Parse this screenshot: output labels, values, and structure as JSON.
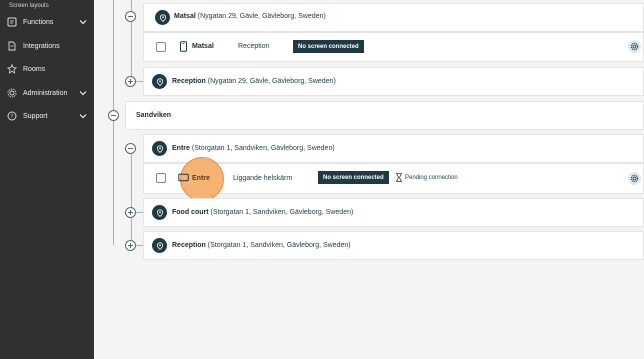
{
  "sidebar": {
    "breadcrumb": "Screen layouts",
    "items": [
      {
        "label": "Functions",
        "icon": "functions-icon",
        "has_chevron": true
      },
      {
        "label": "Integrations",
        "icon": "integrations-icon",
        "has_chevron": false
      },
      {
        "label": "Rooms",
        "icon": "rooms-icon",
        "has_chevron": false
      },
      {
        "label": "Administration",
        "icon": "gear-icon",
        "has_chevron": true
      },
      {
        "label": "Support",
        "icon": "help-icon",
        "has_chevron": true
      }
    ]
  },
  "tree": {
    "matsal": {
      "name": "Matsal",
      "address": "(Nygatan 29, Gävle, Gävleborg, Sweden)"
    },
    "matsal_screen": {
      "name": "Matsal",
      "layout": "Reception",
      "status": "No screen connected"
    },
    "reception_gavle": {
      "name": "Reception",
      "address": "(Nygatan 29, Gävle, Gävleborg, Sweden)"
    },
    "sandviken": {
      "name": "Sandviken"
    },
    "entre": {
      "name": "Entre",
      "address": "(Storgatan 1, Sandviken, Gävleborg, Sweden)"
    },
    "entre_screen": {
      "name": "Entre",
      "layout": "Liggande helskärm",
      "status": "No screen connected",
      "pending": "Pending connection"
    },
    "food_court": {
      "name": "Food court",
      "address": "(Storgatan 1, Sandviken, Gävleborg, Sweden)"
    },
    "reception_sandviken": {
      "name": "Reception",
      "address": "(Storgatan 1, Sandviken, Gävleborg, Sweden)"
    }
  },
  "colors": {
    "sidebar": "#303030",
    "accent": "#1f3a44",
    "highlight": "#f4a65c"
  }
}
